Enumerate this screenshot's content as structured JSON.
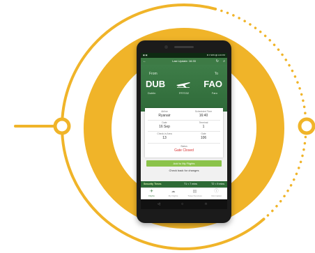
{
  "statusbar": {
    "left": "▣ ▣",
    "right": "⚙ ▾ 98% ▮ 4:20 PM"
  },
  "appbar": {
    "title": "Last Update: 16:33"
  },
  "flight": {
    "from_label": "From",
    "to_label": "To",
    "from_code": "DUB",
    "to_code": "FAO",
    "from_city": "Dublin",
    "to_city": "Faro",
    "number": "FR7032"
  },
  "details": {
    "airline_label": "Airline",
    "airline": "Ryanair",
    "sched_label": "Scheduled Time",
    "sched_time": "16:40",
    "date_label": "Date",
    "date": "16 Sep",
    "terminal_label": "Terminal",
    "terminal": "1",
    "checkin_label": "Check-in Area",
    "checkin": "13",
    "gate_label": "Gate",
    "gate": "106",
    "status_label": "Status",
    "status": "Gate Closed"
  },
  "actions": {
    "add_label": "Add to My Flights",
    "check_label": "Check back for changes"
  },
  "security": {
    "label": "Security Times",
    "t1": "T1 < 7 mins",
    "t2": "T2 < 9 mins"
  },
  "tabs": [
    {
      "label": "Flights"
    },
    {
      "label": "My Flights"
    },
    {
      "label": "Travel Services"
    },
    {
      "label": "Information"
    }
  ],
  "colors": {
    "accent": "#f0b429",
    "app_green": "#3d7a45",
    "button_green": "#8bc34a",
    "status_red": "#d83131"
  }
}
